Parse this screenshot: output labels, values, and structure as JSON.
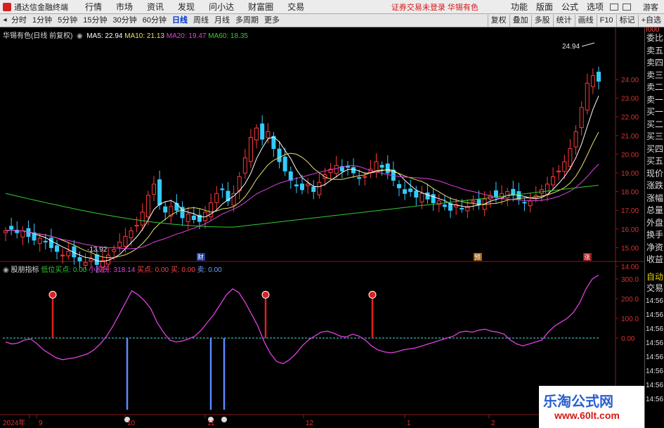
{
  "topbar": {
    "app_title": "通达信金融终端",
    "menus": [
      "行情",
      "市场",
      "资讯",
      "发现",
      "问小达",
      "财富圈",
      "交易"
    ],
    "notice": "证券交易未登录  华锡有色",
    "right_menus": [
      "功能",
      "版面",
      "公式",
      "选项"
    ],
    "guest": "游客"
  },
  "tabbar": {
    "periods": [
      "分时",
      "1分钟",
      "5分钟",
      "15分钟",
      "30分钟",
      "60分钟",
      "日线",
      "周线",
      "月线",
      "多周期",
      "更多"
    ],
    "active": "日线",
    "right_tabs": [
      "复权",
      "叠加",
      "多股",
      "统计",
      "画线",
      "F10",
      "标记",
      "+自选"
    ]
  },
  "main_chart": {
    "stock": "华锡有色(日线 前复权)",
    "ma5": "MA5: 22.94",
    "ma10": "MA10: 21.13",
    "ma20": "MA20: 19.47",
    "ma60": "MA60: 18.35",
    "colors": {
      "ma5": "#ffffff",
      "ma10": "#e8e066",
      "ma20": "#e040e0",
      "ma60": "#33cc33",
      "up": "#ff3a3a",
      "down": "#33ccff"
    },
    "price_ticks": [
      "24.00",
      "23.00",
      "22.00",
      "21.00",
      "20.00",
      "19.00",
      "18.00",
      "17.00",
      "16.00",
      "15.00",
      "14.00"
    ],
    "high_label": "24.94",
    "low_label": "13.92",
    "markers": [
      "财",
      "预",
      "涨"
    ]
  },
  "indicator": {
    "name": "股朋指标",
    "low_buy": "低位买点: 0.00",
    "retail": "小股民: 318.14",
    "buy_point": "买点: 0.00",
    "buy": "买: 0.00",
    "sell": "卖: 0.00",
    "ticks": [
      "300.0",
      "200.0",
      "100.0",
      "0.00"
    ]
  },
  "x_axis": {
    "labels": [
      "2024年",
      "9",
      "10",
      "11",
      "12",
      "1",
      "2"
    ]
  },
  "sidebar": {
    "items": [
      "委比",
      "卖五",
      "卖四",
      "卖三",
      "卖二",
      "卖一",
      "买一",
      "买二",
      "买三",
      "买四",
      "买五",
      "现价",
      "涨跌",
      "涨幅",
      "总量",
      "外盘",
      "换手",
      "净资",
      "收益"
    ],
    "lower_items": [
      "自动",
      "交易"
    ],
    "times": [
      "14:56",
      "14:56",
      "14:56",
      "14:56",
      "14:56",
      "14:56",
      "14:56",
      "14:56"
    ],
    "top_label": "I000"
  },
  "watermark": {
    "title": "乐淘公式网",
    "url": "www.60lt.com"
  }
}
